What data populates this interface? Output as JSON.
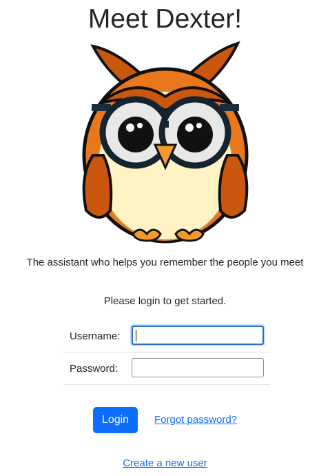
{
  "header": {
    "title": "Meet Dexter!"
  },
  "mascot": {
    "icon": "owl-mascot-icon"
  },
  "tagline": "The assistant who helps you remember the people you meet",
  "login_prompt": "Please login to get started.",
  "form": {
    "username_label": "Username:",
    "username_value": "",
    "password_label": "Password:",
    "password_value": ""
  },
  "actions": {
    "login_label": "Login",
    "forgot_label": "Forgot password?",
    "create_label": "Create a new user"
  },
  "colors": {
    "primary": "#0d6efd",
    "owl_orange": "#c9570e",
    "owl_belly": "#fff3c4"
  }
}
